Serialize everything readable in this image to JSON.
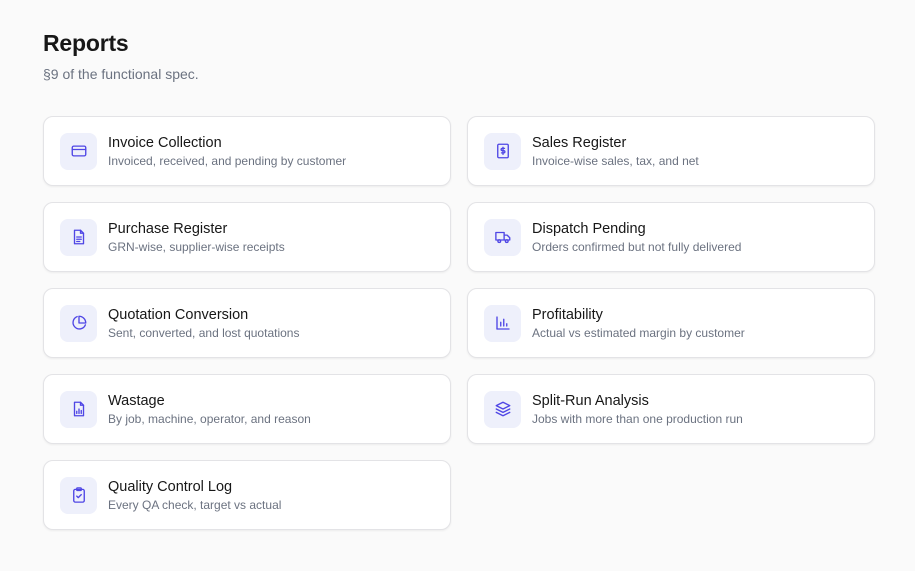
{
  "header": {
    "title": "Reports",
    "subtitle": "§9 of the functional spec."
  },
  "colors": {
    "accent": "#4f46e5",
    "icon_tile_bg": "#eef0fb",
    "card_border": "#e3e3e6",
    "page_bg": "#fafafa"
  },
  "reports": [
    {
      "title": "Invoice Collection",
      "description": "Invoiced, received, and pending by customer",
      "icon": "credit-card-icon"
    },
    {
      "title": "Sales Register",
      "description": "Invoice-wise sales, tax, and net",
      "icon": "dollar-receipt-icon"
    },
    {
      "title": "Purchase Register",
      "description": "GRN-wise, supplier-wise receipts",
      "icon": "document-text-icon"
    },
    {
      "title": "Dispatch Pending",
      "description": "Orders confirmed but not fully delivered",
      "icon": "truck-icon"
    },
    {
      "title": "Quotation Conversion",
      "description": "Sent, converted, and lost quotations",
      "icon": "pie-chart-icon"
    },
    {
      "title": "Profitability",
      "description": "Actual vs estimated margin by customer",
      "icon": "bar-chart-icon"
    },
    {
      "title": "Wastage",
      "description": "By job, machine, operator, and reason",
      "icon": "document-chart-icon"
    },
    {
      "title": "Split-Run Analysis",
      "description": "Jobs with more than one production run",
      "icon": "layers-icon"
    },
    {
      "title": "Quality Control Log",
      "description": "Every QA check, target vs actual",
      "icon": "clipboard-check-icon"
    }
  ]
}
